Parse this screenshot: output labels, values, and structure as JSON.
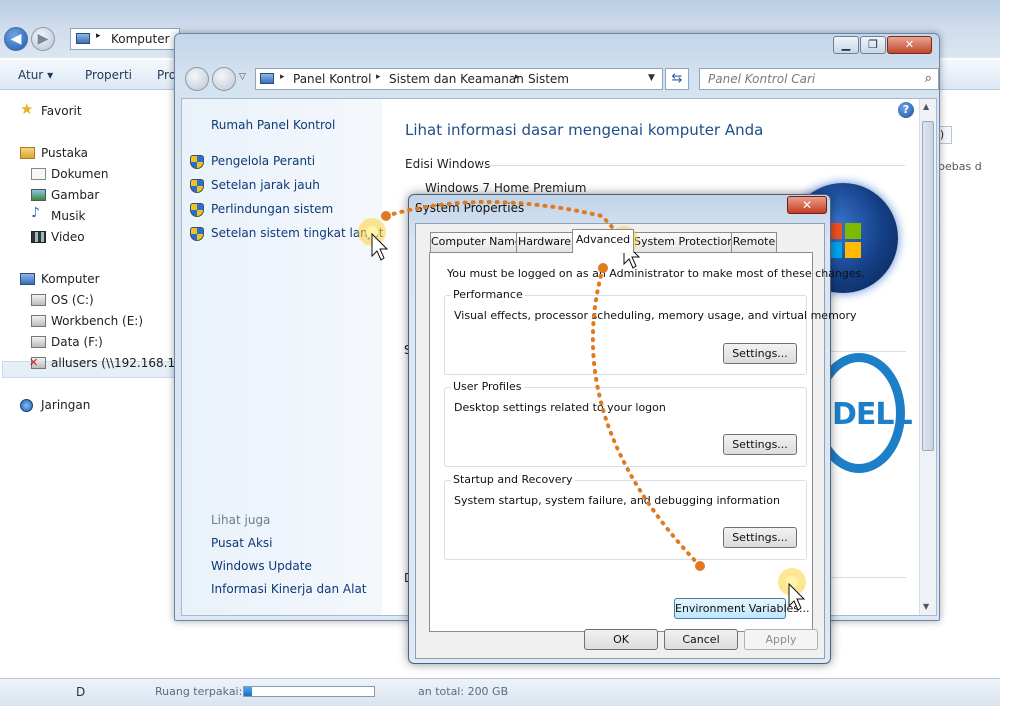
{
  "explorer": {
    "address": "Komputer",
    "toolbar": {
      "atur": "Atur",
      "atur_arrow": "▾",
      "properti": "Properti",
      "third": "Pro"
    },
    "nav": {
      "favorit": "Favorit",
      "pustaka": "Pustaka",
      "dokumen": "Dokumen",
      "gambar": "Gambar",
      "musik": "Musik",
      "video": "Video",
      "komputer": "Komputer",
      "os": "OS (C:)",
      "workbench": "Workbench (E:)",
      "data": "Data (F:)",
      "allusers": "allusers (\\\\192.168.1.250",
      "jaringan": "Jaringan"
    },
    "status": {
      "left": "D",
      "ruang_label": "Ruang terpakai:",
      "total": "an total:  200 GB"
    },
    "right_fragment": "bebas d"
  },
  "control_panel": {
    "breadcrumbs": [
      "Panel Kontrol",
      "Sistem dan Keamanan",
      "Sistem"
    ],
    "search_placeholder": "Panel Kontrol Cari",
    "left_links": {
      "home": "Rumah Panel Kontrol",
      "device_manager": "Pengelola Peranti",
      "remote": "Setelan jarak jauh",
      "protection": "Perlindungan sistem",
      "advanced": "Setelan sistem tingkat lanjut"
    },
    "see_also": {
      "header": "Lihat juga",
      "pusat_aksi": "Pusat Aksi",
      "windows_update": "Windows Update",
      "informasi": "Informasi Kinerja dan Alat"
    },
    "heading": "Lihat informasi dasar mengenai komputer Anda",
    "edition_label": "Edisi Windows",
    "edition_value": "Windows 7 Home Premium",
    "logo_text": "DELL",
    "help": "?",
    "side_fragments": {
      "s": "S",
      "d": "D"
    }
  },
  "system_properties": {
    "title": "System Properties",
    "close_glyph": "✕",
    "tabs": [
      "Computer Name",
      "Hardware",
      "Advanced",
      "System Protection",
      "Remote"
    ],
    "active_tab": "Advanced",
    "admin_note": "You must be logged on as an Administrator to make most of these changes.",
    "groups": [
      {
        "label": "Performance",
        "description": "Visual effects, processor scheduling, memory usage, and virtual memory",
        "button": "Settings..."
      },
      {
        "label": "User Profiles",
        "description": "Desktop settings related to your logon",
        "button": "Settings..."
      },
      {
        "label": "Startup and Recovery",
        "description": "System startup, system failure, and debugging information",
        "button": "Settings..."
      }
    ],
    "env_button": "Environment Variables...",
    "ok": "OK",
    "cancel": "Cancel",
    "apply": "Apply"
  },
  "colors": {
    "annotation_dots": "#e07a1f",
    "link_blue": "#0d3a78",
    "heading_blue": "#1e4e8a"
  }
}
